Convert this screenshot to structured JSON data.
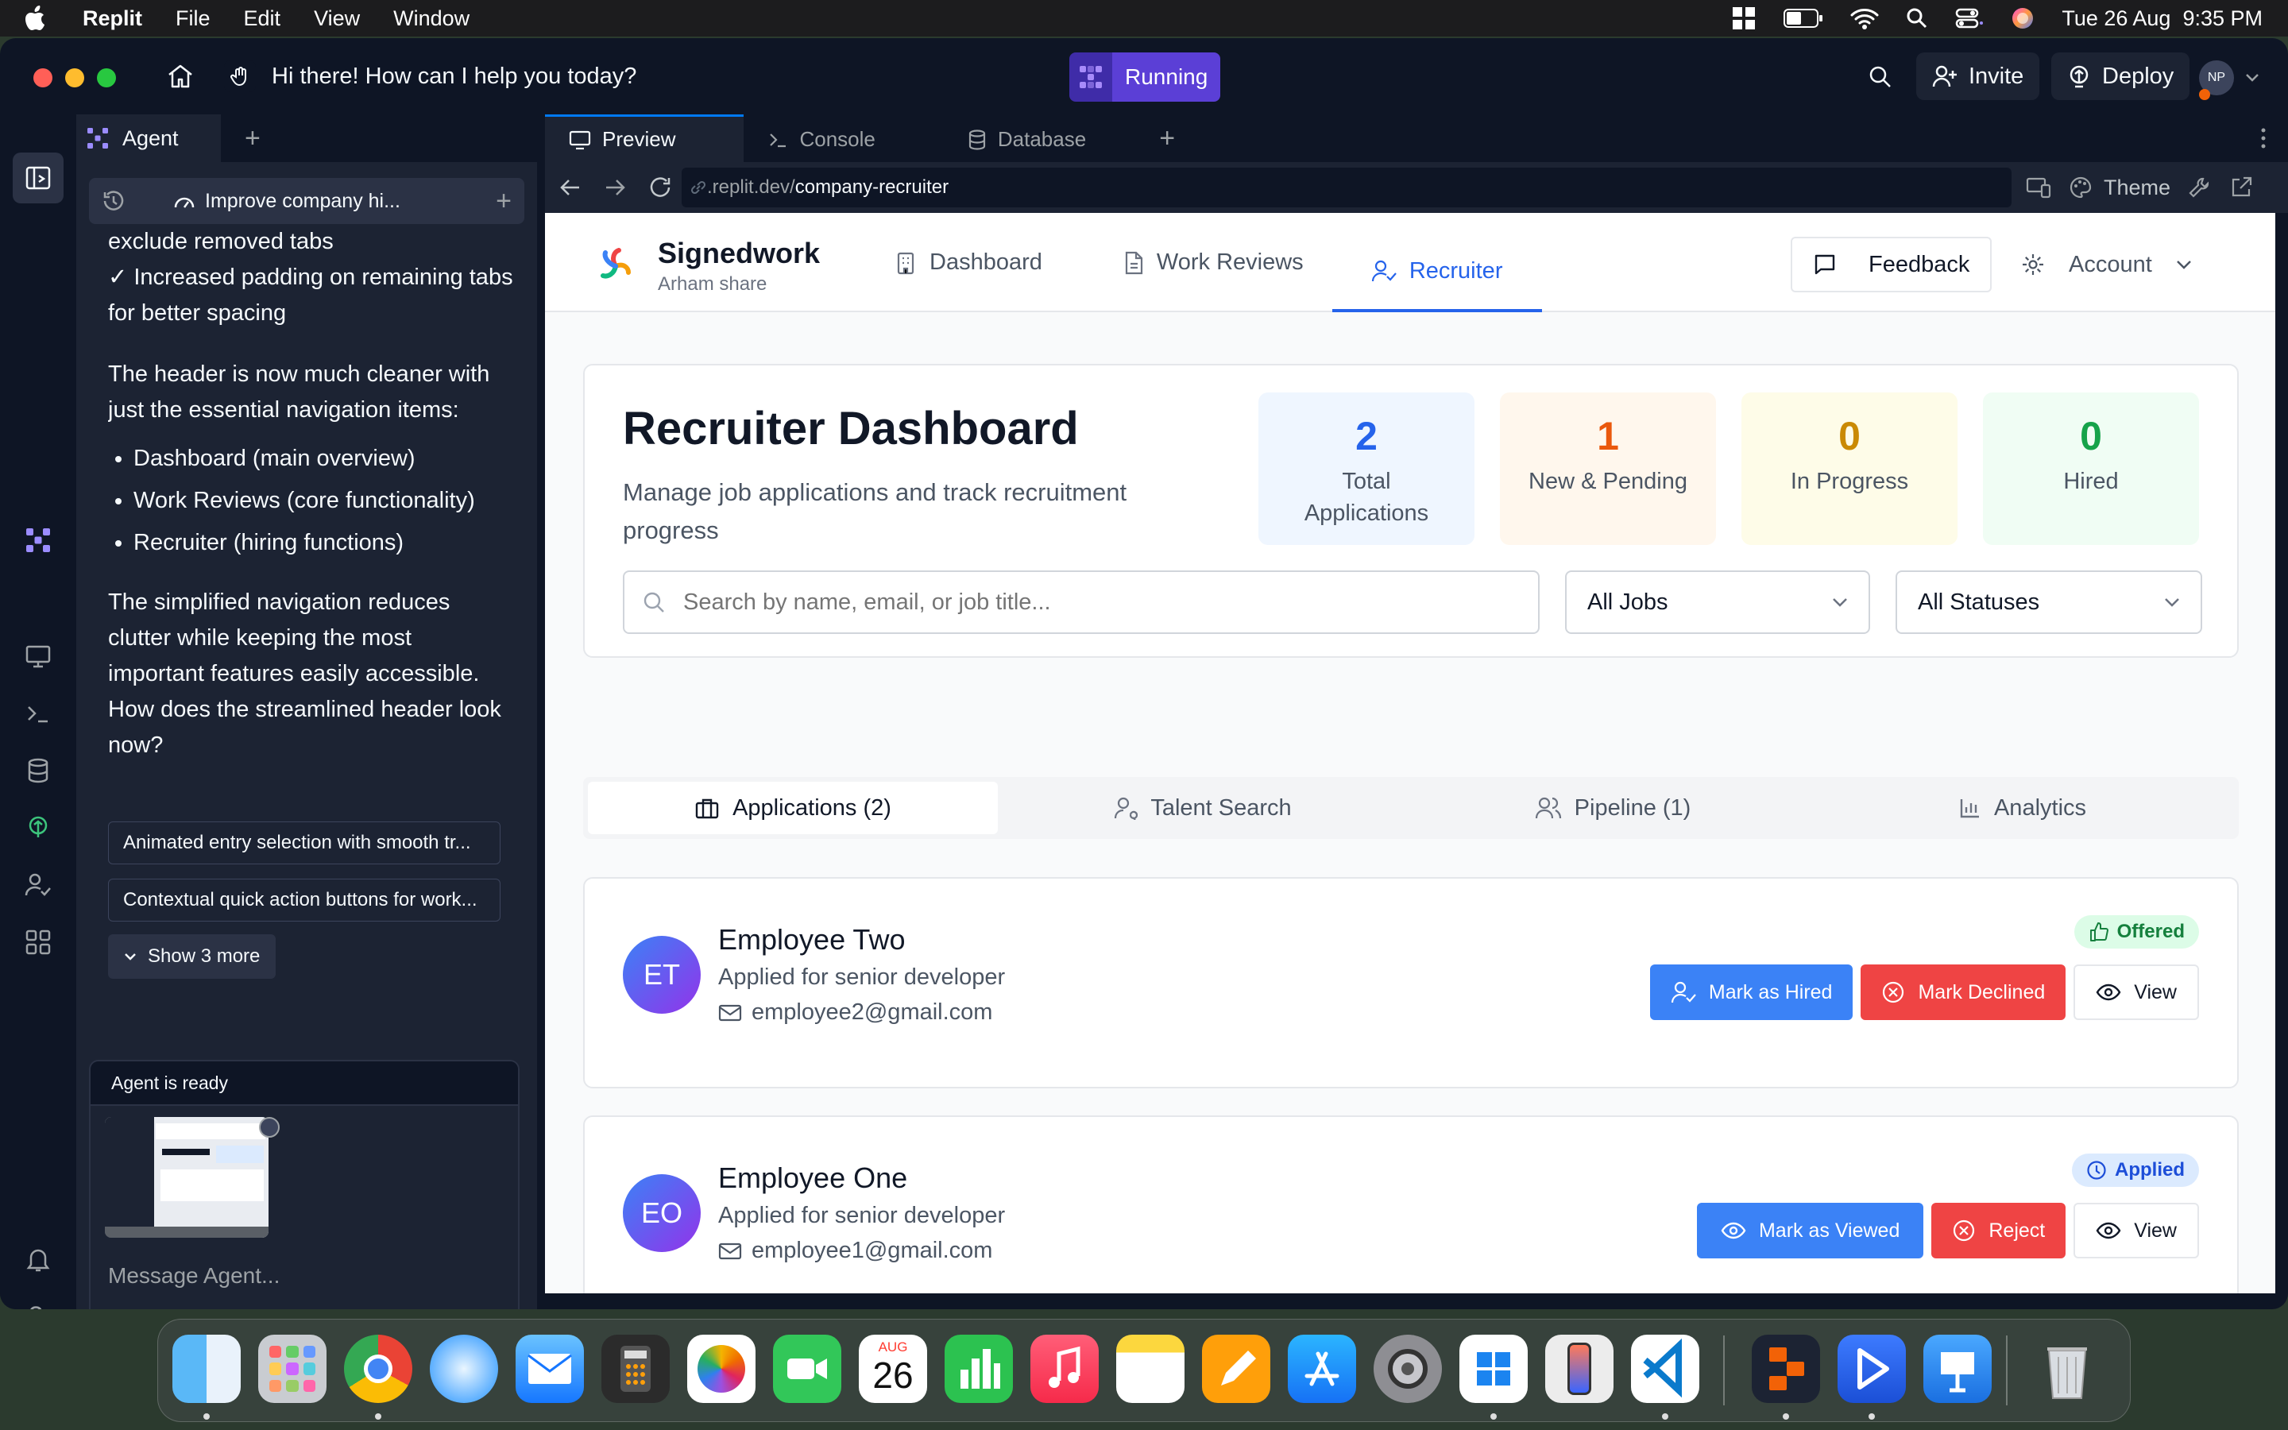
{
  "menubar": {
    "app": "Replit",
    "items": [
      "File",
      "Edit",
      "View",
      "Window"
    ],
    "datetime": "Tue 26 Aug  9:35 PM"
  },
  "titlebar": {
    "prompt": "Hi there! How can I help you today?",
    "running": "Running",
    "invite": "Invite",
    "deploy": "Deploy",
    "avatar": "NP"
  },
  "agent": {
    "tab": "Agent",
    "thread": "Improve company hi...",
    "messages": {
      "line1": "exclude removed tabs",
      "line2": "✓ Increased padding on remaining tabs for better spacing",
      "para1": "The header is now much cleaner with just the essential navigation items:",
      "bullets": [
        "Dashboard (main overview)",
        "Work Reviews (core functionality)",
        "Recruiter (hiring functions)"
      ],
      "para2": "The simplified navigation reduces clutter while keeping the most important features easily accessible. How does the streamlined header look now?"
    },
    "suggestions": [
      "Animated entry selection with smooth tr...",
      "Contextual quick action buttons for work..."
    ],
    "show_more": "Show 3 more",
    "status": "Agent is ready",
    "placeholder": "Message Agent..."
  },
  "tabs": {
    "preview": "Preview",
    "console": "Console",
    "database": "Database"
  },
  "url": {
    "prefix": ".replit.dev/",
    "path": "company-recruiter",
    "theme": "Theme"
  },
  "app": {
    "brand": "Signedwork",
    "sub": "Arham share",
    "nav": [
      "Dashboard",
      "Work Reviews",
      "Recruiter"
    ],
    "feedback": "Feedback",
    "account": "Account",
    "title": "Recruiter Dashboard",
    "subtitle": "Manage job applications and track recruitment progress",
    "stats": [
      {
        "value": "2",
        "label": "Total Applications",
        "color": "#2563eb",
        "bg": "#eff6ff"
      },
      {
        "value": "1",
        "label": "New & Pending",
        "color": "#ea580c",
        "bg": "#fff7ed"
      },
      {
        "value": "0",
        "label": "In Progress",
        "color": "#ca8a04",
        "bg": "#fefce8"
      },
      {
        "value": "0",
        "label": "Hired",
        "color": "#16a34a",
        "bg": "#f0fdf4"
      }
    ],
    "search_placeholder": "Search by name, email, or job title...",
    "jobs_filter": "All Jobs",
    "status_filter": "All Statuses",
    "tabs": [
      "Applications (2)",
      "Talent Search",
      "Pipeline (1)",
      "Analytics"
    ],
    "applicants": [
      {
        "initials": "ET",
        "name": "Employee Two",
        "role": "Applied for senior developer",
        "email": "employee2@gmail.com",
        "badge": "Offered",
        "primary": "Mark as Hired",
        "secondary": "Mark Declined",
        "view": "View"
      },
      {
        "initials": "EO",
        "name": "Employee One",
        "role": "Applied for senior developer",
        "email": "employee1@gmail.com",
        "badge": "Applied",
        "primary": "Mark as Viewed",
        "secondary": "Reject",
        "view": "View"
      }
    ]
  },
  "dock": {
    "calendar_month": "AUG",
    "calendar_day": "26"
  }
}
